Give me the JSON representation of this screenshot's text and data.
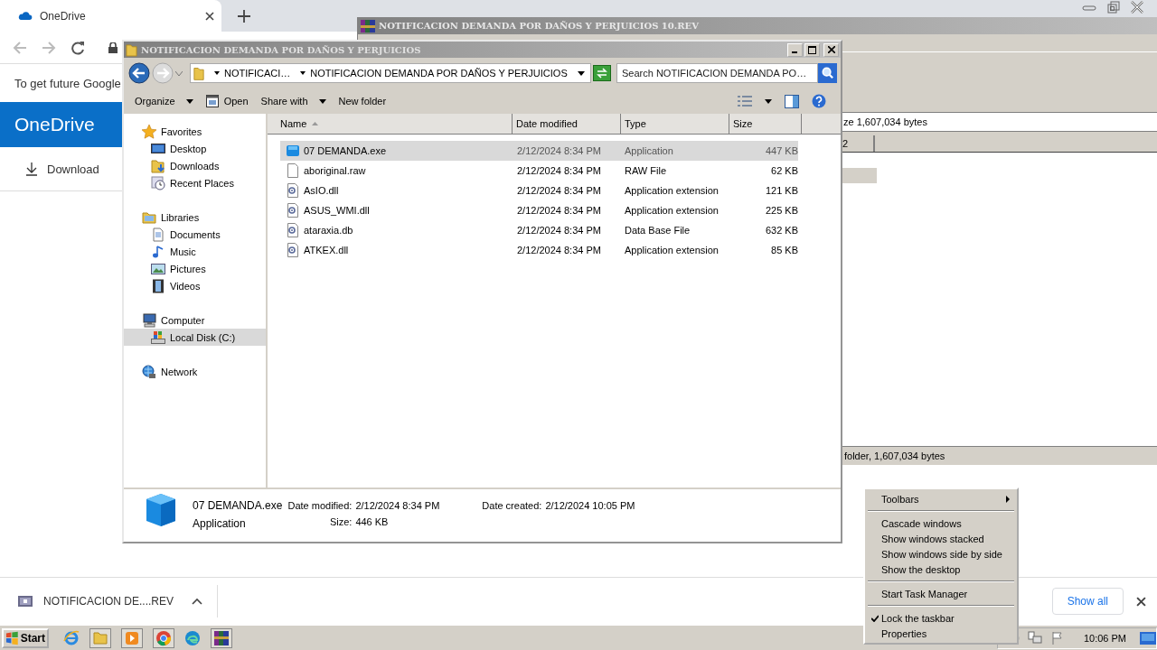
{
  "browser": {
    "tab_title": "OneDrive",
    "infobar_text": "To get future Google",
    "header_title": "OneDrive",
    "download_link": "Download",
    "download_shelf": {
      "file": "NOTIFICACION DE....REV",
      "show_all": "Show all"
    }
  },
  "archive_window": {
    "title": "NOTIFICACION DEMANDA POR DAÑOS Y PERJUICIOS 10.REV",
    "info_text": "ze 1,607,034 bytes",
    "column_1": "2",
    "status": "folder, 1,607,034 bytes"
  },
  "explorer": {
    "title": "NOTIFICACION DEMANDA POR DAÑOS Y PERJUICIOS",
    "breadcrumbs": [
      "NOTIFICACI…",
      "NOTIFICACION DEMANDA POR DAÑOS Y PERJUICIOS"
    ],
    "search": {
      "placeholder": "Search NOTIFICACION DEMANDA PO…"
    },
    "toolbar": [
      {
        "label": "Organize",
        "kind": "menu"
      },
      {
        "label": "Open",
        "kind": "open"
      },
      {
        "label": "Share with",
        "kind": "menu"
      },
      {
        "label": "New folder",
        "kind": "plain"
      }
    ],
    "nav": [
      {
        "label": "Favorites",
        "kind": "star",
        "selected": false,
        "children": [
          {
            "label": "Desktop",
            "kind": "desktop",
            "selected": false
          },
          {
            "label": "Downloads",
            "kind": "downloads",
            "selected": false
          },
          {
            "label": "Recent Places",
            "kind": "recent",
            "selected": false
          }
        ]
      },
      {
        "label": "Libraries",
        "kind": "library",
        "selected": false,
        "children": [
          {
            "label": "Documents",
            "kind": "document",
            "selected": false
          },
          {
            "label": "Music",
            "kind": "music",
            "selected": false
          },
          {
            "label": "Pictures",
            "kind": "pictures",
            "selected": false
          },
          {
            "label": "Videos",
            "kind": "videos",
            "selected": false
          }
        ]
      },
      {
        "label": "Computer",
        "kind": "computer",
        "selected": false,
        "children": [
          {
            "label": "Local Disk (C:)",
            "kind": "disk",
            "selected": true
          }
        ]
      },
      {
        "label": "Network",
        "kind": "network",
        "selected": false
      }
    ],
    "columns": [
      {
        "label": "Name",
        "sorted": true
      },
      {
        "label": "Date modified",
        "sorted": false
      },
      {
        "label": "Type",
        "sorted": false
      },
      {
        "label": "Size",
        "sorted": false
      }
    ],
    "files": [
      {
        "name": "07 DEMANDA.exe",
        "date_modified": "2/12/2024 8:34 PM",
        "type": "Application",
        "size": "447 KB",
        "kind": "app",
        "selected": true
      },
      {
        "name": "aboriginal.raw",
        "date_modified": "2/12/2024 8:34 PM",
        "type": "RAW File",
        "size": "62 KB",
        "kind": "blank",
        "selected": false
      },
      {
        "name": "AsIO.dll",
        "date_modified": "2/12/2024 8:34 PM",
        "type": "Application extension",
        "size": "121 KB",
        "kind": "settings",
        "selected": false
      },
      {
        "name": "ASUS_WMI.dll",
        "date_modified": "2/12/2024 8:34 PM",
        "type": "Application extension",
        "size": "225 KB",
        "kind": "settings",
        "selected": false
      },
      {
        "name": "ataraxia.db",
        "date_modified": "2/12/2024 8:34 PM",
        "type": "Data Base File",
        "size": "632 KB",
        "kind": "settings",
        "selected": false
      },
      {
        "name": "ATKEX.dll",
        "date_modified": "2/12/2024 8:34 PM",
        "type": "Application extension",
        "size": "85 KB",
        "kind": "settings",
        "selected": false
      }
    ],
    "details": {
      "name": "07 DEMANDA.exe",
      "type": "Application",
      "fields": [
        {
          "label": "Date modified:",
          "value": "2/12/2024 8:34 PM"
        },
        {
          "label": "Size:",
          "value": "446 KB"
        },
        {
          "label": "Date created:",
          "value": "2/12/2024 10:05 PM"
        }
      ]
    }
  },
  "context_menu": {
    "groups": [
      {
        "items": [
          {
            "label": "Toolbars",
            "kind": "submenu",
            "checked": false
          }
        ]
      },
      {
        "items": [
          {
            "label": "Cascade windows",
            "kind": "command",
            "checked": false
          },
          {
            "label": "Show windows stacked",
            "kind": "command",
            "checked": false
          },
          {
            "label": "Show windows side by side",
            "kind": "command",
            "checked": false
          },
          {
            "label": "Show the desktop",
            "kind": "command",
            "checked": false
          }
        ]
      },
      {
        "items": [
          {
            "label": "Start Task Manager",
            "kind": "command",
            "checked": false
          }
        ]
      },
      {
        "items": [
          {
            "label": "Lock the taskbar",
            "kind": "command",
            "checked": true
          },
          {
            "label": "Properties",
            "kind": "command",
            "checked": false
          }
        ]
      }
    ]
  },
  "taskbar": {
    "start": "Start",
    "clock": "10:06 PM"
  }
}
